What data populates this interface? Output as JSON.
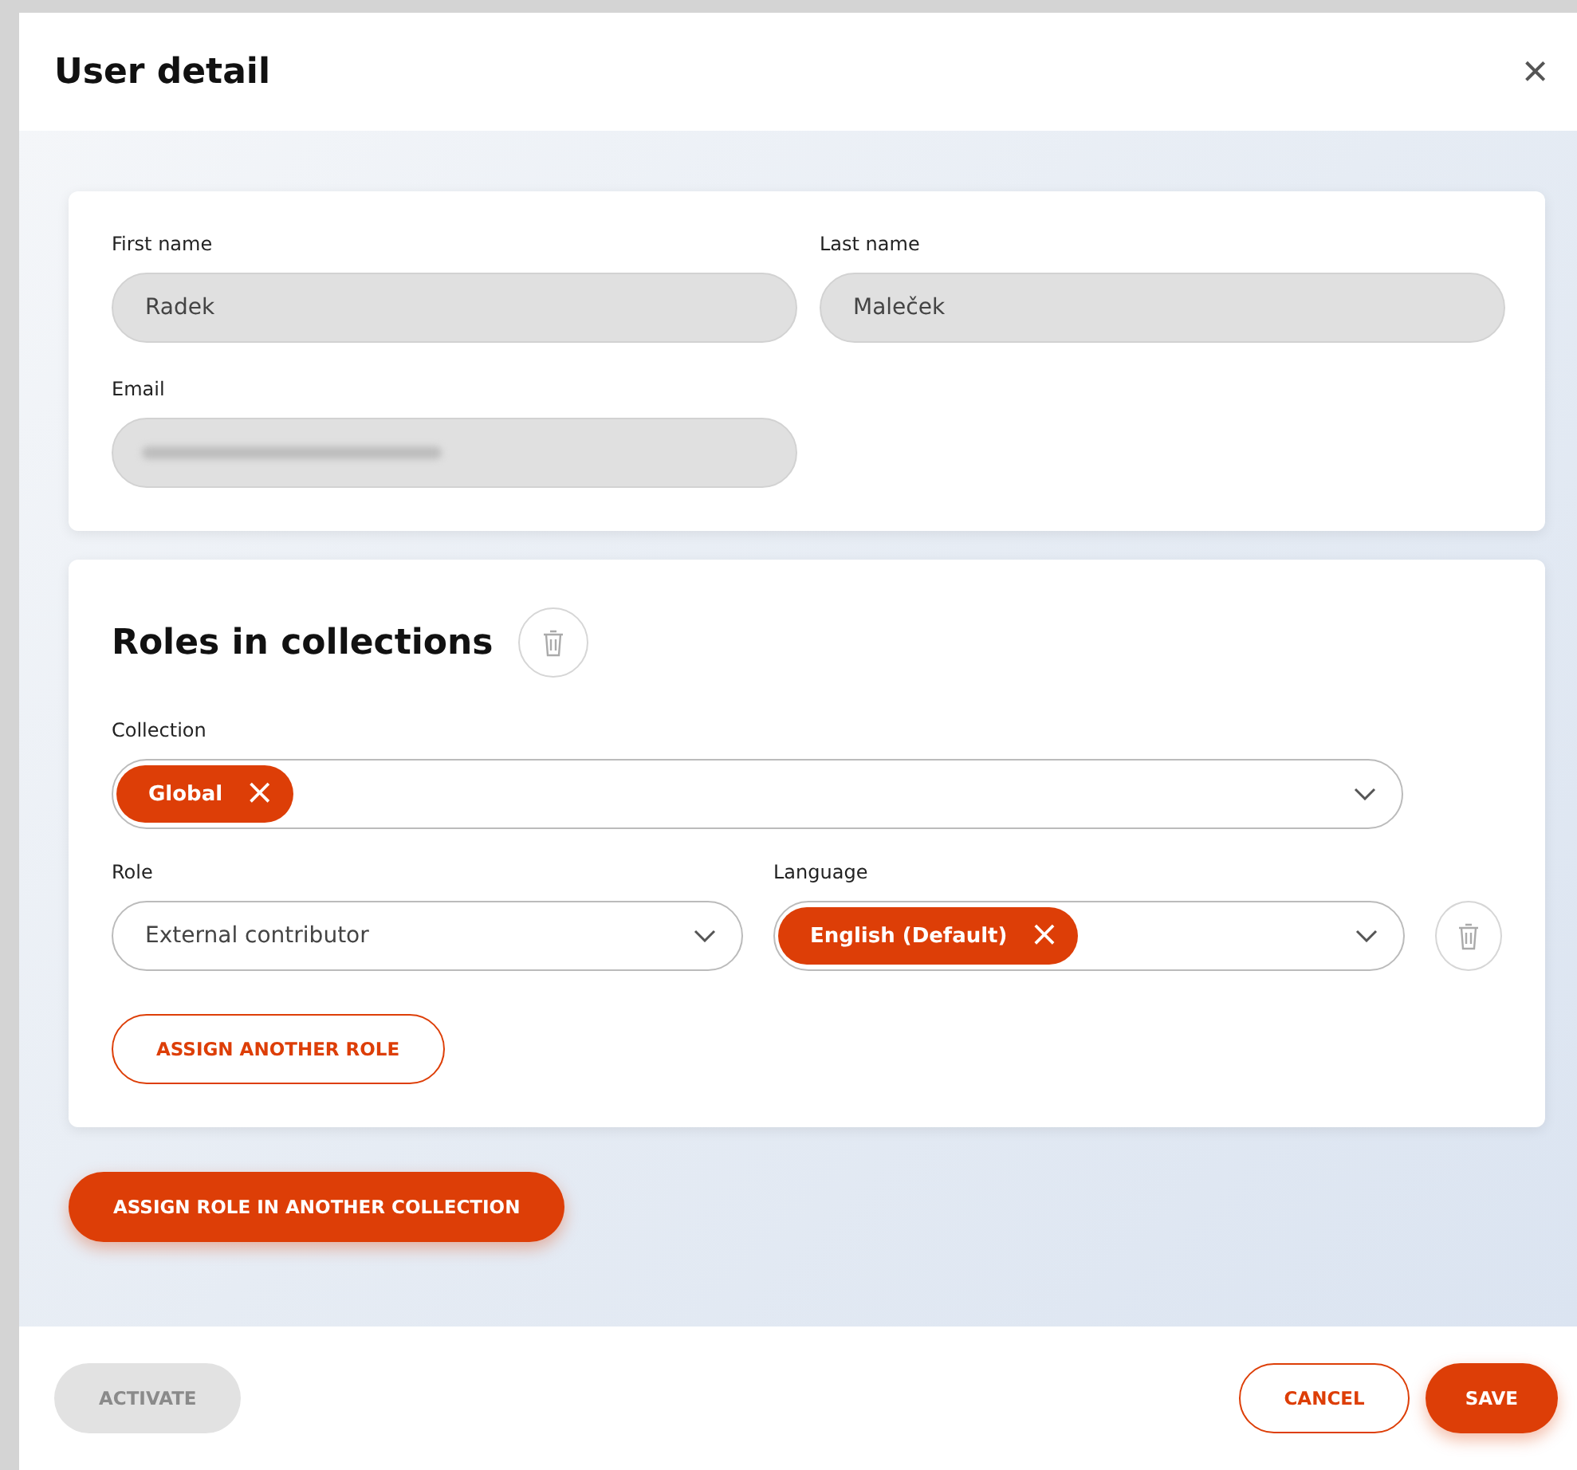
{
  "dialog": {
    "title": "User detail",
    "close": "×"
  },
  "profile": {
    "fields": [
      {
        "label": "First name",
        "value": "Radek",
        "disabled": true,
        "redacted": false
      },
      {
        "label": "Last name",
        "value": "Maleček",
        "disabled": true,
        "redacted": false
      },
      {
        "label": "Email",
        "disabled": true,
        "redacted": true
      }
    ]
  },
  "roles_section": {
    "title": "Roles in collections",
    "collection": {
      "label": "Collection",
      "tags": [
        {
          "label": "Global",
          "remove": "×"
        }
      ]
    },
    "assignments": [
      {
        "role": {
          "label": "Role",
          "value": "External contributor"
        },
        "language": {
          "label": "Language",
          "tags": [
            {
              "label": "English (Default)",
              "remove": "×"
            }
          ]
        }
      }
    ],
    "assign_another_role": "ASSIGN ANOTHER ROLE"
  },
  "assign_collection_button": "ASSIGN ROLE IN ANOTHER COLLECTION",
  "footer": {
    "buttons": [
      {
        "label": "ACTIVATE",
        "kind": "secondary",
        "disabled": true
      },
      {
        "label": "CANCEL",
        "kind": "outline",
        "disabled": false
      },
      {
        "label": "SAVE",
        "kind": "primary",
        "disabled": false
      }
    ]
  }
}
